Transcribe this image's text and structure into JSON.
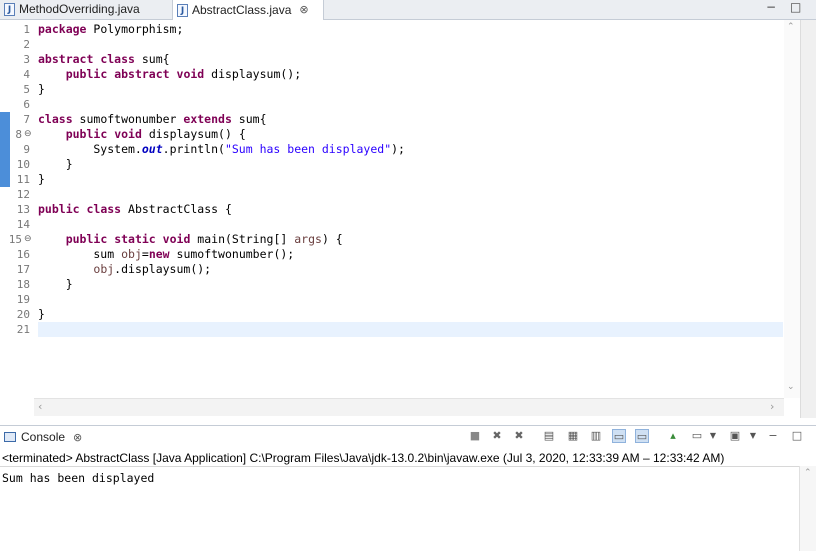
{
  "tabs": [
    {
      "label": "MethodOverriding.java",
      "active": false
    },
    {
      "label": "AbstractClass.java",
      "active": true
    }
  ],
  "tab_close_glyph": "⊗",
  "window_controls": {
    "minimize": "−",
    "maximize": "□"
  },
  "editor": {
    "line_numbers": [
      "1",
      "2",
      "3",
      "4",
      "5",
      "6",
      "7",
      "8",
      "9",
      "10",
      "11",
      "12",
      "13",
      "14",
      "15",
      "16",
      "17",
      "18",
      "19",
      "20",
      "21"
    ]
  },
  "console": {
    "title": "Console",
    "status": "<terminated> AbstractClass [Java Application] C:\\Program Files\\Java\\jdk-13.0.2\\bin\\javaw.exe  (Jul 3, 2020, 12:33:39 AM – 12:33:42 AM)",
    "output": "Sum has been displayed",
    "toolbar_icons": [
      "terminate-icon",
      "remove-launch-icon",
      "remove-all-launches-icon",
      "clear-console-icon",
      "scroll-lock-icon",
      "word-wrap-icon",
      "show-on-stdout-icon",
      "show-on-stderr-icon",
      "pin-console-icon",
      "display-selected-console-icon",
      "open-console-icon",
      "minimize-icon",
      "maximize-icon"
    ]
  },
  "colors": {
    "keyword": "#7f0055",
    "string": "#2a00ff",
    "field": "#0000c0",
    "current_line": "#e8f2fe"
  }
}
